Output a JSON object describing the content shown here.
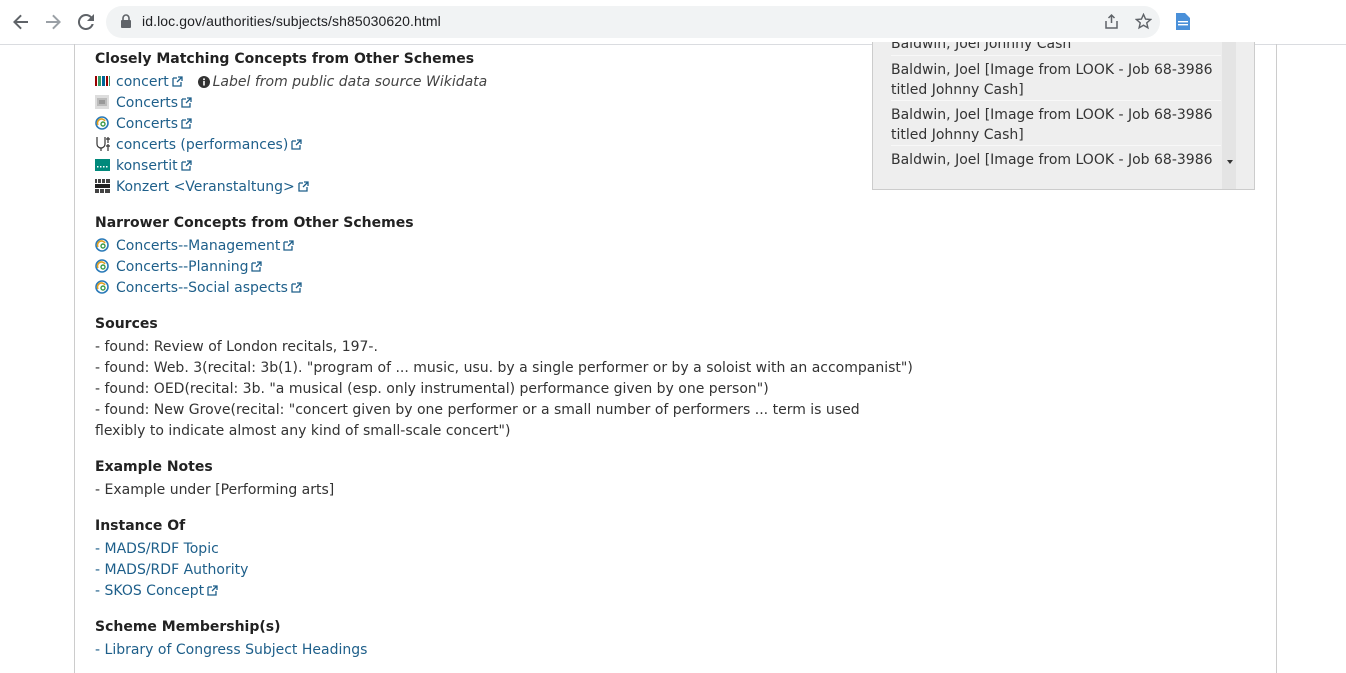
{
  "browser": {
    "url": "id.loc.gov/authorities/subjects/sh85030620.html"
  },
  "sidebar": {
    "items": [
      "Baldwin, Joel Johnny Cash",
      "Baldwin, Joel [Image from LOOK - Job 68-3986 titled Johnny Cash]",
      "Baldwin, Joel [Image from LOOK - Job 68-3986 titled Johnny Cash]",
      "Baldwin, Joel [Image from LOOK - Job 68-3986"
    ]
  },
  "closely_matching": {
    "heading": "Closely Matching Concepts from Other Schemes",
    "items": [
      {
        "label": "concert",
        "icon": "wikidata-icon"
      },
      {
        "label": "Concerts",
        "icon": "loc-gallery-icon"
      },
      {
        "label": "Concerts",
        "icon": "fast-icon"
      },
      {
        "label": "concerts (performances)",
        "icon": "getty-aat-icon"
      },
      {
        "label": "konsertit",
        "icon": "finto-icon"
      },
      {
        "label": "Konzert <Veranstaltung>",
        "icon": "dnb-icon"
      }
    ],
    "note": "Label from public data source Wikidata"
  },
  "narrower": {
    "heading": "Narrower Concepts from Other Schemes",
    "items": [
      {
        "label": "Concerts--Management",
        "icon": "fast-icon"
      },
      {
        "label": "Concerts--Planning",
        "icon": "fast-icon"
      },
      {
        "label": "Concerts--Social aspects",
        "icon": "fast-icon"
      }
    ]
  },
  "sources": {
    "heading": "Sources",
    "items": [
      "- found: Review of London recitals, 197-.",
      "- found: Web. 3(recital: 3b(1). \"program of ... music, usu. by a single performer or by a soloist with an accompanist\")",
      "- found: OED(recital: 3b. \"a musical (esp. only instrumental) performance given by one person\")",
      "- found: New Grove(recital: \"concert given by one performer or a small number of performers ... term is used flexibly to indicate almost any kind of small-scale concert\")"
    ]
  },
  "example_notes": {
    "heading": "Example Notes",
    "items": [
      "- Example under [Performing arts]"
    ]
  },
  "instance_of": {
    "heading": "Instance Of",
    "prefix": "- ",
    "items": [
      "MADS/RDF Topic",
      "MADS/RDF Authority",
      "SKOS Concept"
    ]
  },
  "scheme_membership": {
    "heading": "Scheme Membership(s)",
    "prefix": "- ",
    "items": [
      "Library of Congress Subject Headings"
    ]
  }
}
